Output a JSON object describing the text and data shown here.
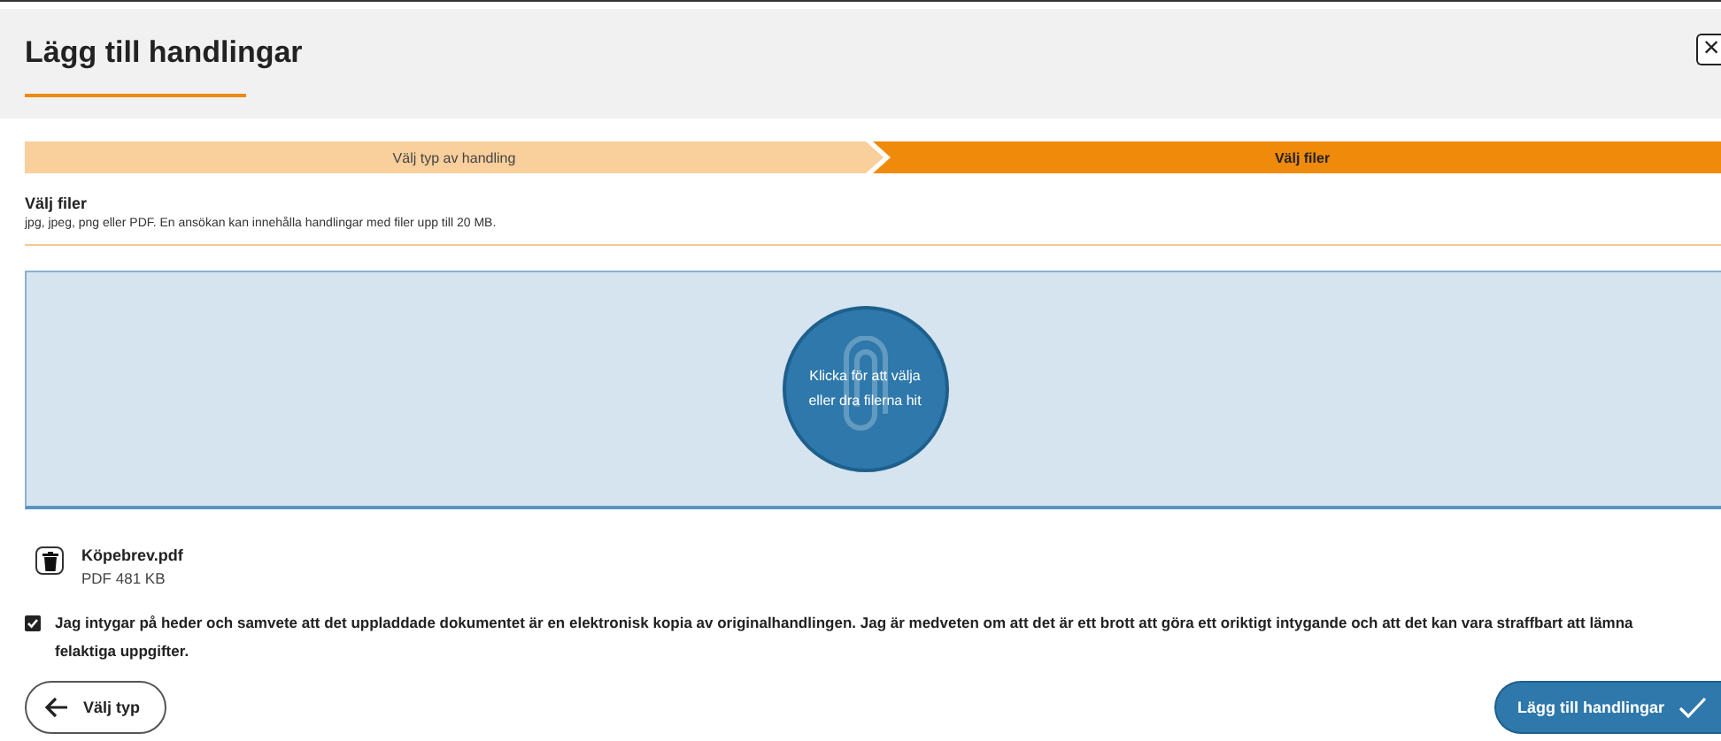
{
  "dialog": {
    "title": "Lägg till handlingar",
    "close_label": "×"
  },
  "steps": [
    {
      "label": "Välj typ av handling",
      "selected": false
    },
    {
      "label": "Välj filer",
      "selected": true
    }
  ],
  "section": {
    "heading": "Välj filer",
    "description": "jpg, jpeg, png eller PDF. En ansökan kan innehålla handlingar med filer upp till 20 MB."
  },
  "dropzone": {
    "text": "Klicka för att välja eller dra filerna hit"
  },
  "files": [
    {
      "name": "Köpebrev.pdf",
      "size": "PDF 481 KB"
    }
  ],
  "consent": {
    "checked": true,
    "text": "Jag intygar på heder och samvete att det uppladdade dokumentet är en elektronisk kopia av originalhandlingen. Jag är medveten om att det är ett brott att göra ett oriktigt intygande och att det kan vara straffbart att lämna felaktiga uppgifter."
  },
  "buttons": [
    {
      "kind": "back",
      "label": "Välj typ"
    },
    {
      "kind": "submit",
      "label": "Lägg till handlingar"
    }
  ]
}
